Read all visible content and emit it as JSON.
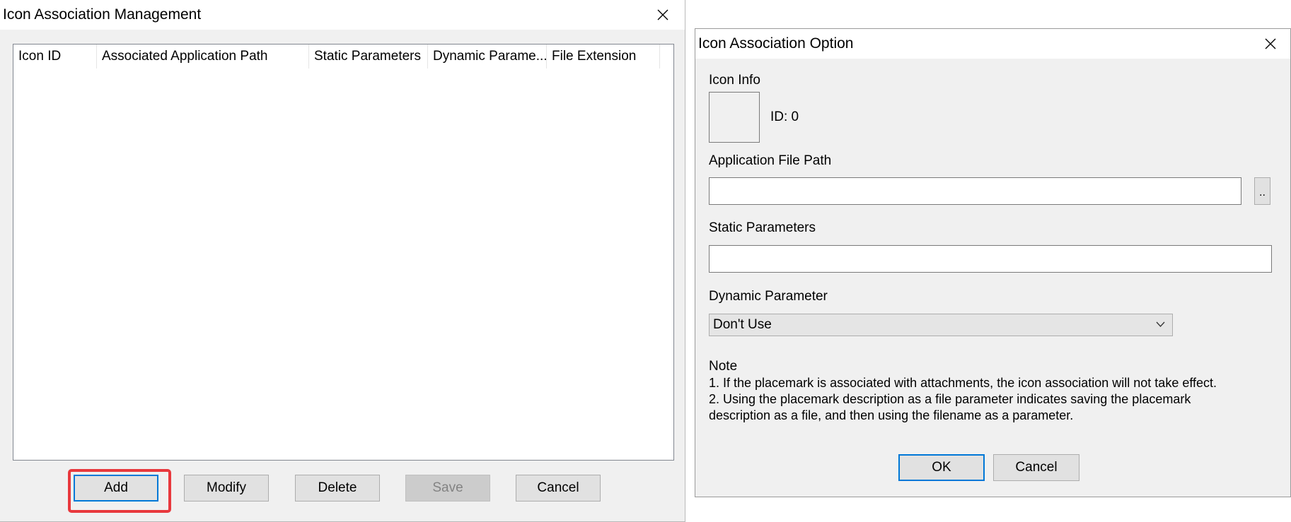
{
  "manage_window": {
    "title": "Icon Association Management",
    "columns": [
      "Icon ID",
      "Associated Application Path",
      "Static Parameters",
      "Dynamic Parame...",
      "File Extension"
    ],
    "rows": [],
    "buttons": {
      "add": "Add",
      "modify": "Modify",
      "delete": "Delete",
      "save": "Save",
      "cancel": "Cancel"
    }
  },
  "option_window": {
    "title": "Icon Association Option",
    "icon_info_label": "Icon Info",
    "icon_id_text": "ID: 0",
    "app_path_label": "Application File Path",
    "app_path_value": "",
    "browse_label": "..",
    "static_params_label": "Static Parameters",
    "static_params_value": "",
    "dynamic_param_label": "Dynamic Parameter",
    "dynamic_param_selected": "Don't Use",
    "note_title": "Note",
    "note_lines": [
      "1. If the placemark is associated with attachments, the icon association will not take effect.",
      "2. Using the placemark description as a file parameter indicates saving the placemark",
      "description as a file, and then using the filename as a parameter."
    ],
    "ok_label": "OK",
    "cancel_label": "Cancel"
  },
  "colors": {
    "highlight": "#e8383d",
    "focus_border": "#0078d7",
    "dialog_bg": "#f0f0f0"
  },
  "icons": [
    "close-icon",
    "chevron-down-icon"
  ]
}
